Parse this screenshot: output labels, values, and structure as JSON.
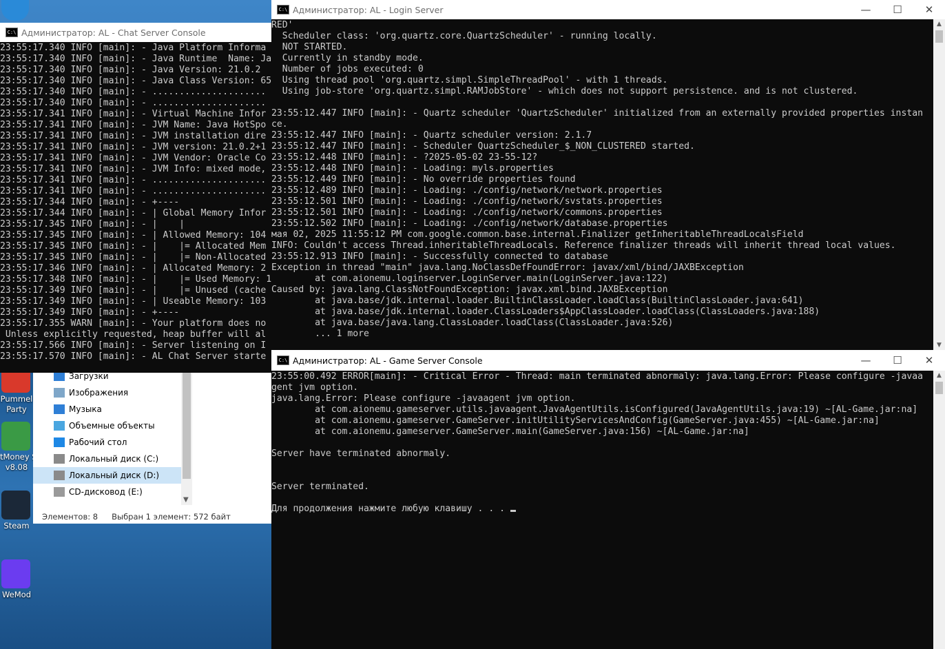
{
  "desktop": {
    "icons": [
      {
        "label": "Pummel\nParty",
        "name": "desktop-icon-pummel-party",
        "color": "#d9392b"
      },
      {
        "label": "tMoney S\nv8.08",
        "name": "desktop-icon-money",
        "color": "#3a9a45"
      },
      {
        "label": "Steam",
        "name": "desktop-icon-steam",
        "color": "#1b2838"
      },
      {
        "label": "WeMod",
        "name": "desktop-icon-wemod",
        "color": "#6b3cf0"
      }
    ]
  },
  "explorer": {
    "items": [
      {
        "label": "Загрузки",
        "icon": "download-icon"
      },
      {
        "label": "Изображения",
        "icon": "pictures-icon"
      },
      {
        "label": "Музыка",
        "icon": "music-icon"
      },
      {
        "label": "Объемные объекты",
        "icon": "3d-objects-icon"
      },
      {
        "label": "Рабочий стол",
        "icon": "desktop-folder-icon"
      },
      {
        "label": "Локальный диск (C:)",
        "icon": "drive-icon"
      },
      {
        "label": "Локальный диск (D:)",
        "icon": "drive-icon"
      },
      {
        "label": "CD-дисковод (E:)",
        "icon": "cd-drive-icon"
      }
    ],
    "status_count": "Элементов: 8",
    "status_selected": "Выбран 1 элемент: 572 байт"
  },
  "chat_window": {
    "title": "Администратор:  AL - Chat Server Console",
    "lines": [
      "23:55:17.340 INFO [main]: - Java Platform Informa",
      "23:55:17.340 INFO [main]: - Java Runtime  Name: Ja",
      "23:55:17.340 INFO [main]: - Java Version: 21.0.2",
      "23:55:17.340 INFO [main]: - Java Class Version: 65",
      "23:55:17.340 INFO [main]: - .....................",
      "23:55:17.340 INFO [main]: - .....................",
      "23:55:17.341 INFO [main]: - Virtual Machine Infor",
      "23:55:17.341 INFO [main]: - JVM Name: Java HotSpo",
      "23:55:17.341 INFO [main]: - JVM installation dire",
      "23:55:17.341 INFO [main]: - JVM version: 21.0.2+1",
      "23:55:17.341 INFO [main]: - JVM Vendor: Oracle Co",
      "23:55:17.341 INFO [main]: - JVM Info: mixed mode,",
      "23:55:17.341 INFO [main]: - .....................",
      "23:55:17.341 INFO [main]: - .....................",
      "23:55:17.344 INFO [main]: - +----",
      "23:55:17.344 INFO [main]: - | Global Memory Infor",
      "23:55:17.345 INFO [main]: - |    |",
      "23:55:17.345 INFO [main]: - | Allowed Memory: 104",
      "23:55:17.345 INFO [main]: - |    |= Allocated Mem",
      "23:55:17.345 INFO [main]: - |    |= Non-Allocated",
      "23:55:17.346 INFO [main]: - | Allocated Memory: 2",
      "23:55:17.348 INFO [main]: - |    |= Used Memory: 1",
      "23:55:17.349 INFO [main]: - |    |= Unused (cache",
      "23:55:17.349 INFO [main]: - | Useable Memory: 103",
      "23:55:17.349 INFO [main]: - +----",
      "23:55:17.355 WARN [main]: - Your platform does no",
      " Unless explicitly requested, heap buffer will al",
      "23:55:17.566 INFO [main]: - Server listening on I",
      "23:55:17.570 INFO [main]: - AL Chat Server starte"
    ]
  },
  "login_window": {
    "title": "Администратор:  AL - Login Server",
    "lines": [
      "RED'",
      "  Scheduler class: 'org.quartz.core.QuartzScheduler' - running locally.",
      "  NOT STARTED.",
      "  Currently in standby mode.",
      "  Number of jobs executed: 0",
      "  Using thread pool 'org.quartz.simpl.SimpleThreadPool' - with 1 threads.",
      "  Using job-store 'org.quartz.simpl.RAMJobStore' - which does not support persistence. and is not clustered.",
      "",
      "23:55:12.447 INFO [main]: - Quartz scheduler 'QuartzScheduler' initialized from an externally provided properties instan",
      "ce.",
      "23:55:12.447 INFO [main]: - Quartz scheduler version: 2.1.7",
      "23:55:12.447 INFO [main]: - Scheduler QuartzScheduler_$_NON_CLUSTERED started.",
      "23:55:12.448 INFO [main]: - ?2025-05-02 23-55-12?",
      "23:55:12.448 INFO [main]: - Loading: myls.properties",
      "23:55:12.449 INFO [main]: - No override properties found",
      "23:55:12.489 INFO [main]: - Loading: ./config/network/network.properties",
      "23:55:12.501 INFO [main]: - Loading: ./config/network/svstats.properties",
      "23:55:12.501 INFO [main]: - Loading: ./config/network/commons.properties",
      "23:55:12.502 INFO [main]: - Loading: ./config/network/database.properties",
      "мая 02, 2025 11:55:12 PM com.google.common.base.internal.Finalizer getInheritableThreadLocalsField",
      "INFO: Couldn't access Thread.inheritableThreadLocals. Reference finalizer threads will inherit thread local values.",
      "23:55:12.913 INFO [main]: - Successfully connected to database",
      "Exception in thread \"main\" java.lang.NoClassDefFoundError: javax/xml/bind/JAXBException",
      "        at com.aionemu.loginserver.LoginServer.main(LoginServer.java:122)",
      "Caused by: java.lang.ClassNotFoundException: javax.xml.bind.JAXBException",
      "        at java.base/jdk.internal.loader.BuiltinClassLoader.loadClass(BuiltinClassLoader.java:641)",
      "        at java.base/jdk.internal.loader.ClassLoaders$AppClassLoader.loadClass(ClassLoaders.java:188)",
      "        at java.base/java.lang.ClassLoader.loadClass(ClassLoader.java:526)",
      "        ... 1 more"
    ]
  },
  "game_window": {
    "title": "Администратор:  AL - Game Server Console",
    "lines": [
      "23:55:00.492 ERROR[main]: - Critical Error - Thread: main terminated abnormaly: java.lang.Error: Please configure -javaa",
      "gent jvm option.",
      "java.lang.Error: Please configure -javaagent jvm option.",
      "        at com.aionemu.gameserver.utils.javaagent.JavaAgentUtils.isConfigured(JavaAgentUtils.java:19) ~[AL-Game.jar:na]",
      "        at com.aionemu.gameserver.GameServer.initUtilityServicesAndConfig(GameServer.java:455) ~[AL-Game.jar:na]",
      "        at com.aionemu.gameserver.GameServer.main(GameServer.java:156) ~[AL-Game.jar:na]",
      "",
      "Server have terminated abnormaly.",
      "",
      "",
      "Server terminated.",
      "",
      "Для продолжения нажмите любую клавишу . . . "
    ]
  },
  "window_buttons": {
    "minimize": "—",
    "maximize": "☐",
    "close": "✕"
  },
  "cmd_icon_text": "C:\\"
}
